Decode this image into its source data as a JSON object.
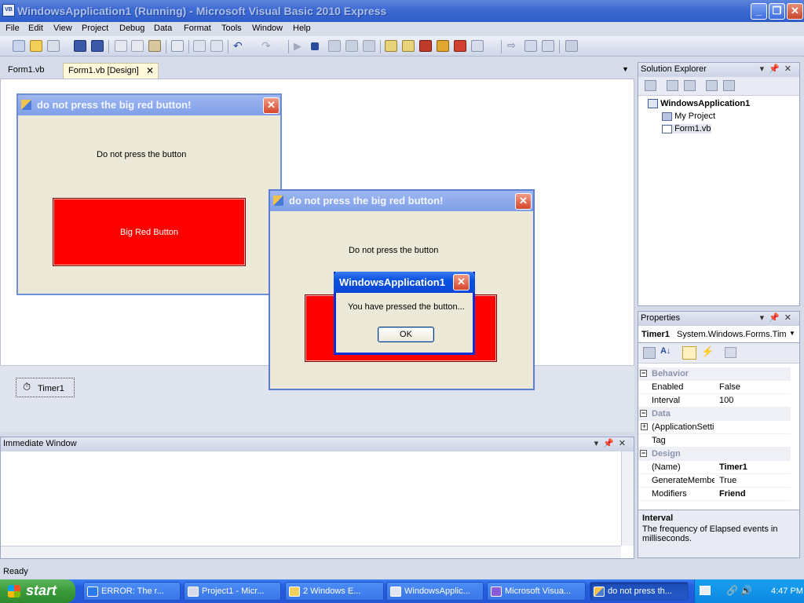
{
  "window": {
    "title": "WindowsApplication1 (Running) - Microsoft Visual Basic 2010 Express",
    "app_icon": "VB",
    "controls": [
      "minimize-icon",
      "restore-icon",
      "close-icon"
    ]
  },
  "menu": [
    "File",
    "Edit",
    "View",
    "Project",
    "Debug",
    "Data",
    "Format",
    "Tools",
    "Window",
    "Help"
  ],
  "toolbar_icons": [
    "new-project-icon",
    "open-icon",
    "add-item-icon",
    "save-icon",
    "save-all-icon",
    "cut-icon",
    "copy-icon",
    "paste-icon",
    "find-icon",
    "comment-icon",
    "uncomment-icon",
    "undo-icon",
    "redo-icon",
    "start-debug-icon",
    "stop-icon",
    "step-into-icon",
    "step-over-icon",
    "step-out-icon",
    "solution-explorer-icon",
    "properties-icon",
    "toolbox-icon",
    "object-browser-icon",
    "error-list-icon",
    "immediate-icon",
    "navigate-icon",
    "bookmark-icon",
    "options-icon"
  ],
  "doc_tabs": {
    "tab1": "Form1.vb",
    "tab2": "Form1.vb [Design]",
    "close": "✕"
  },
  "designer_form": {
    "title": "do not press the big red button!",
    "label": "Do not press the button",
    "button": "Big Red Button"
  },
  "component_tray": {
    "timer": "Timer1"
  },
  "running_form": {
    "title": "do not press the big red button!",
    "label": "Do not press the button"
  },
  "message_box": {
    "title": "WindowsApplication1",
    "text": "You have pressed the button...",
    "ok": "OK"
  },
  "solution_explorer": {
    "title": "Solution Explorer",
    "root": "WindowsApplication1",
    "items": [
      "My Project",
      "Form1.vb"
    ]
  },
  "properties": {
    "title": "Properties",
    "object": "Timer1",
    "object_type": "System.Windows.Forms.Timer",
    "categories": [
      {
        "name": "Behavior",
        "rows": [
          {
            "name": "Enabled",
            "value": "False"
          },
          {
            "name": "Interval",
            "value": "100"
          }
        ]
      },
      {
        "name": "Data",
        "rows": [
          {
            "name": "(ApplicationSettings)",
            "value": ""
          },
          {
            "name": "Tag",
            "value": ""
          }
        ]
      },
      {
        "name": "Design",
        "rows": [
          {
            "name": "(Name)",
            "value": "Timer1"
          },
          {
            "name": "GenerateMember",
            "value": "True"
          },
          {
            "name": "Modifiers",
            "value": "Friend"
          }
        ]
      }
    ],
    "desc_title": "Interval",
    "desc_text": "The frequency of Elapsed events in milliseconds."
  },
  "immediate_window": {
    "title": "Immediate Window"
  },
  "status": "Ready",
  "taskbar": {
    "start": "start",
    "tasks": [
      {
        "label": "ERROR: The r...",
        "icon": "ie-icon"
      },
      {
        "label": "Project1 - Micr...",
        "icon": "vb6-icon"
      },
      {
        "label": "2 Windows E...",
        "icon": "folder-icon"
      },
      {
        "label": "WindowsApplic...",
        "icon": "vb-icon"
      },
      {
        "label": "Microsoft Visua...",
        "icon": "vs-icon"
      },
      {
        "label": "do not press th...",
        "icon": "form-icon"
      }
    ],
    "clock": "4:47 PM"
  }
}
